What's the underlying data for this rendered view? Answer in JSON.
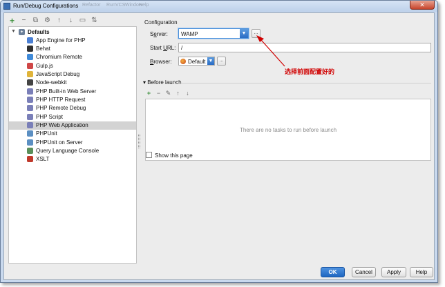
{
  "window": {
    "title": "Run/Debug Configurations",
    "menu_ghost": [
      "Refactor",
      "Run",
      "VCS",
      "Window",
      "Help"
    ],
    "close_glyph": "✕"
  },
  "toolbar": {
    "add": "+",
    "remove": "−",
    "copy": "⧉",
    "settings": "⚙",
    "up": "↑",
    "down": "↓",
    "folder": "▭",
    "sort": "⇅"
  },
  "tree": {
    "root": {
      "label": "Defaults",
      "icon": "wrench-icon"
    },
    "items": [
      {
        "label": "App Engine for PHP",
        "icon": "app-engine-icon",
        "color": "#4a7fd4"
      },
      {
        "label": "Behat",
        "icon": "behat-icon",
        "color": "#2f2f2f"
      },
      {
        "label": "Chromium Remote",
        "icon": "chromium-icon",
        "color": "#3f8ad8"
      },
      {
        "label": "Gulp.js",
        "icon": "gulp-icon",
        "color": "#cf4646"
      },
      {
        "label": "JavaScript Debug",
        "icon": "javascript-debug-icon",
        "color": "#e0b43a"
      },
      {
        "label": "Node-webkit",
        "icon": "node-webkit-icon",
        "color": "#444444"
      },
      {
        "label": "PHP Built-in Web Server",
        "icon": "php-icon",
        "color": "#7a7fb8"
      },
      {
        "label": "PHP HTTP Request",
        "icon": "php-icon",
        "color": "#7a7fb8"
      },
      {
        "label": "PHP Remote Debug",
        "icon": "php-icon",
        "color": "#7a7fb8"
      },
      {
        "label": "PHP Script",
        "icon": "php-icon",
        "color": "#7a7fb8"
      },
      {
        "label": "PHP Web Application",
        "icon": "php-icon",
        "color": "#7a7fb8",
        "selected": true
      },
      {
        "label": "PHPUnit",
        "icon": "phpunit-icon",
        "color": "#5b8fc2"
      },
      {
        "label": "PHPUnit on Server",
        "icon": "phpunit-icon",
        "color": "#5b8fc2"
      },
      {
        "label": "Query Language Console",
        "icon": "console-icon",
        "color": "#5a8f5a"
      },
      {
        "label": "XSLT",
        "icon": "xslt-icon",
        "color": "#c0392b"
      }
    ]
  },
  "config": {
    "section_title": "Configuration",
    "server_label_pre": "S",
    "server_label_u": "e",
    "server_label_post": "rver:",
    "server_value": "WAMP",
    "start_url_label_pre": "Start ",
    "start_url_label_u": "U",
    "start_url_label_post": "RL:",
    "start_url_value": "/",
    "browser_label_pre": "",
    "browser_label_u": "B",
    "browser_label_post": "rowser:",
    "browser_value": "Default",
    "ellipsis": "..."
  },
  "before_launch": {
    "caret": "▾",
    "title": "Before launch",
    "add": "+",
    "remove": "−",
    "edit": "✎",
    "up": "↑",
    "down": "↓",
    "empty_text": "There are no tasks to run before launch",
    "show_page_label": "Show this page"
  },
  "buttons": {
    "ok": "OK",
    "cancel": "Cancel",
    "apply": "Apply",
    "help": "Help"
  },
  "annotation": {
    "text": "选择前面配置好的",
    "color": "#d00000"
  }
}
